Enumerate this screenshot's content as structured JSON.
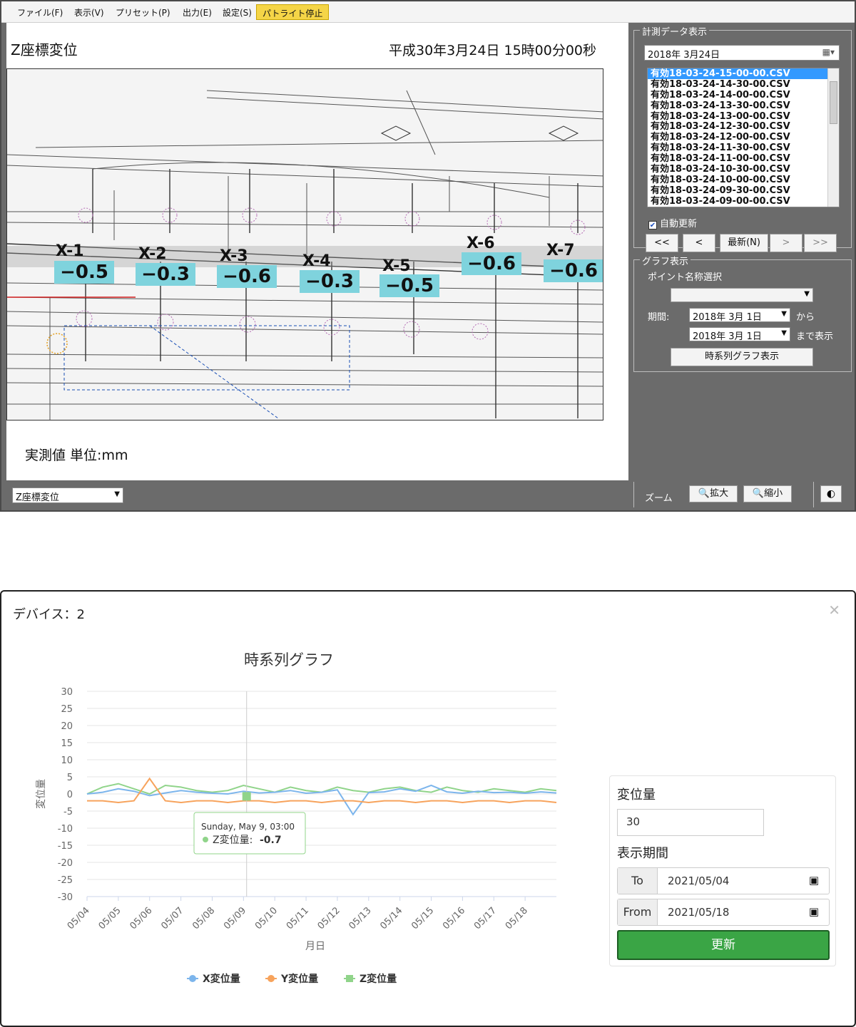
{
  "app": {
    "menu": [
      {
        "label": "ファイル(F)"
      },
      {
        "label": "表示(V)"
      },
      {
        "label": "プリセット(P)"
      },
      {
        "label": "出力(E)"
      },
      {
        "label": "設定(S)"
      },
      {
        "label": "パトライト停止"
      }
    ],
    "view_title": "Z座標変位",
    "view_datetime": "平成30年3月24日 15時00分00秒",
    "unit_label": "実測値 単位:mm",
    "points": [
      {
        "label": "X-1",
        "value": "−0.5"
      },
      {
        "label": "X-2",
        "value": "−0.3"
      },
      {
        "label": "X-3",
        "value": "−0.6"
      },
      {
        "label": "X-4",
        "value": "−0.3"
      },
      {
        "label": "X-5",
        "value": "−0.5"
      },
      {
        "label": "X-6",
        "value": "−0.6"
      },
      {
        "label": "X-7",
        "value": "−0.6"
      }
    ],
    "view_select": "Z座標変位",
    "measure_group": "計測データ表示",
    "date_value": "2018年 3月24日",
    "files": [
      "有効18-03-24-15-00-00.CSV",
      "有効18-03-24-14-30-00.CSV",
      "有効18-03-24-14-00-00.CSV",
      "有効18-03-24-13-30-00.CSV",
      "有効18-03-24-13-00-00.CSV",
      "有効18-03-24-12-30-00.CSV",
      "有効18-03-24-12-00-00.CSV",
      "有効18-03-24-11-30-00.CSV",
      "有効18-03-24-11-00-00.CSV",
      "有効18-03-24-10-30-00.CSV",
      "有効18-03-24-10-00-00.CSV",
      "有効18-03-24-09-30-00.CSV",
      "有効18-03-24-09-00-00.CSV"
    ],
    "auto_update": "自動更新",
    "nav": {
      "first": "<<",
      "prev": "<",
      "latest": "最新(N)",
      "next": ">",
      "last": ">>"
    },
    "graph_group": "グラフ表示",
    "point_select_label": "ポイント名称選択",
    "period_label": "期間:",
    "from_date": "2018年 3月 1日",
    "to_date": "2018年 3月 1日",
    "from_suffix": "から",
    "to_suffix": "まで表示",
    "ts_button": "時系列グラフ表示",
    "zoom_label": "ズーム",
    "zoom_in": "拡大",
    "zoom_out": "縮小"
  },
  "dialog": {
    "title": "デバイス：2",
    "chart_title": "時系列グラフ",
    "ylabel": "変位量",
    "xlabel": "月日",
    "tooltip_date": "Sunday, May 9, 03:00",
    "tooltip_series": "Z変位量:",
    "tooltip_value": "-0.7",
    "side": {
      "disp_label": "変位量",
      "disp_value": "30",
      "period_title": "表示期間",
      "to_label": "To",
      "to_value": "2021/05/04",
      "from_label": "From",
      "from_value": "2021/05/18",
      "refresh": "更新"
    }
  },
  "chart_data": {
    "type": "line",
    "xlabel": "月日",
    "ylabel": "変位量",
    "x_ticks": [
      "05/04",
      "05/05",
      "05/06",
      "05/07",
      "05/08",
      "05/09",
      "05/10",
      "05/11",
      "05/12",
      "05/13",
      "05/14",
      "05/15",
      "05/16",
      "05/17",
      "05/18"
    ],
    "ylim": [
      -30,
      30
    ],
    "y_ticks": [
      30,
      25,
      20,
      15,
      10,
      5,
      0,
      -5,
      -10,
      -15,
      -20,
      -25,
      -30
    ],
    "grid": true,
    "legend": "bottom",
    "series": [
      {
        "name": "X変位量",
        "color": "#7cb5ec",
        "x": [
          4.0,
          4.5,
          5.0,
          5.5,
          6.0,
          6.5,
          7.0,
          7.5,
          8.0,
          8.5,
          9.0,
          9.5,
          10.0,
          10.5,
          11.0,
          11.5,
          12.0,
          12.5,
          13.0,
          13.5,
          14.0,
          14.5,
          15.0,
          15.5,
          16.0,
          16.5,
          17.0,
          17.5,
          18.0,
          18.5,
          19.0
        ],
        "values": [
          0,
          0.5,
          1.5,
          0.8,
          -0.5,
          0.3,
          1.0,
          0.5,
          0.2,
          0,
          0.8,
          0.3,
          0.5,
          1.0,
          0.2,
          0.5,
          1.2,
          -6,
          0.4,
          0.6,
          1.5,
          0.8,
          2.5,
          0.6,
          0.2,
          0.8,
          0.4,
          0.5,
          0.2,
          0.6,
          0.3
        ]
      },
      {
        "name": "Y変位量",
        "color": "#f7a35c",
        "x": [
          4.0,
          4.5,
          5.0,
          5.5,
          6.0,
          6.5,
          7.0,
          7.5,
          8.0,
          8.5,
          9.0,
          9.5,
          10.0,
          10.5,
          11.0,
          11.5,
          12.0,
          12.5,
          13.0,
          13.5,
          14.0,
          14.5,
          15.0,
          15.5,
          16.0,
          16.5,
          17.0,
          17.5,
          18.0,
          18.5,
          19.0
        ],
        "values": [
          -2,
          -2,
          -2.5,
          -2,
          4.5,
          -2,
          -2.5,
          -2,
          -2,
          -2.5,
          -2,
          -2,
          -2.5,
          -2,
          -2,
          -2.5,
          -2,
          -2,
          -2.5,
          -2,
          -2,
          -2.5,
          -2,
          -2,
          -2.5,
          -2,
          -2,
          -2.5,
          -2,
          -2,
          -2.5
        ]
      },
      {
        "name": "Z変位量",
        "color": "#90d48a",
        "x": [
          4.0,
          4.5,
          5.0,
          5.5,
          6.0,
          6.5,
          7.0,
          7.5,
          8.0,
          8.5,
          9.0,
          9.5,
          10.0,
          10.5,
          11.0,
          11.5,
          12.0,
          12.5,
          13.0,
          13.5,
          14.0,
          14.5,
          15.0,
          15.5,
          16.0,
          16.5,
          17.0,
          17.5,
          18.0,
          18.5,
          19.0
        ],
        "values": [
          0,
          2,
          3,
          1.5,
          0,
          2.5,
          2,
          1,
          0.5,
          1,
          2.5,
          1.5,
          0.5,
          2,
          1,
          0.5,
          2,
          1,
          0.5,
          1.5,
          2,
          1,
          0.5,
          2,
          1,
          0.5,
          1.5,
          1,
          0.5,
          1.5,
          1
        ]
      }
    ]
  }
}
